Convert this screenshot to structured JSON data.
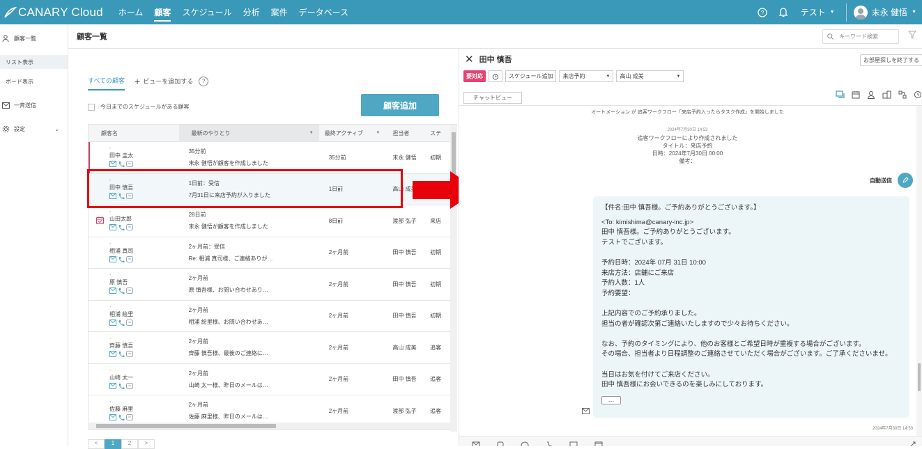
{
  "app": {
    "logo": "CANARY Cloud"
  },
  "nav": [
    {
      "label": "ホーム",
      "active": false
    },
    {
      "label": "顧客",
      "active": true
    },
    {
      "label": "スケジュール",
      "active": false
    },
    {
      "label": "分析",
      "active": false
    },
    {
      "label": "案件",
      "active": false
    },
    {
      "label": "データベース",
      "active": false
    }
  ],
  "topright": {
    "workspace": "テスト",
    "user": "末永 健悟"
  },
  "sidebar": {
    "customer_list": "顧客一覧",
    "list_view": "リスト表示",
    "board_view": "ボード表示",
    "bulk_send": "一斉送信",
    "settings": "設定"
  },
  "page": {
    "title": "顧客一覧",
    "search_placeholder": "キーワード検索"
  },
  "tabs": {
    "all": "すべての顧客",
    "add_view": "ビューを追加する"
  },
  "filter": {
    "today_schedule": "今日までのスケジュールがある顧客"
  },
  "add_button": "顧客追加",
  "table": {
    "headers": [
      "顧客名",
      "最新のやりとり",
      "最終アクティブ",
      "担当者",
      "ステ"
    ],
    "rows": [
      {
        "dash": "-",
        "name": "田中 圭太",
        "latest_time": "35分前",
        "latest_text": "末永 健悟が顧客を作成しました",
        "active": "35分前",
        "owner": "末永 健悟",
        "status": "初期",
        "marker": true,
        "calendar": false,
        "selected": false
      },
      {
        "dash": "-",
        "name": "田中 慎吾",
        "latest_time": "1日前：受信",
        "latest_text": "7月31日に来店予約が入りました",
        "active": "1日前",
        "owner": "高山 成美",
        "status": "",
        "marker": false,
        "calendar": false,
        "selected": true
      },
      {
        "dash": "-",
        "name": "山田太郎",
        "latest_time": "28日前",
        "latest_text": "末永 健悟が顧客を作成しました",
        "active": "8日前",
        "owner": "渡部 弘子",
        "status": "来店",
        "marker": false,
        "calendar": true,
        "selected": false
      },
      {
        "dash": "-",
        "name": "相浦 真司",
        "latest_time": "2ヶ月前：受信",
        "latest_text": "Re: 相浦 真司様、ご連絡ありが…",
        "active": "2ヶ月前",
        "owner": "田中 慎吾",
        "status": "初期",
        "marker": false,
        "calendar": false,
        "selected": false
      },
      {
        "dash": "-",
        "name": "原 慎吾",
        "latest_time": "2ヶ月前",
        "latest_text": "原 慎吾様、お問い合わせあり…",
        "active": "2ヶ月前",
        "owner": "田中 慎吾",
        "status": "初期",
        "marker": false,
        "calendar": false,
        "selected": false
      },
      {
        "dash": "-",
        "name": "相浦 絵里",
        "latest_time": "2ヶ月前",
        "latest_text": "相浦 絵里様、お問い合わせあ…",
        "active": "2ヶ月前",
        "owner": "田中 慎吾",
        "status": "初期",
        "marker": false,
        "calendar": false,
        "selected": false
      },
      {
        "dash": "-",
        "name": "齊藤 慎吾",
        "latest_time": "2ヶ月前",
        "latest_text": "齊藤 慎吾様、最後のご連絡に…",
        "active": "2ヶ月前",
        "owner": "高山 成美",
        "status": "追客",
        "marker": false,
        "calendar": false,
        "selected": false
      },
      {
        "dash": "-",
        "name": "山崎 太一",
        "latest_time": "2ヶ月前",
        "latest_text": "山崎 太一様、昨日のメールは…",
        "active": "2ヶ月前",
        "owner": "田中 慎吾",
        "status": "追客",
        "marker": false,
        "calendar": false,
        "selected": false
      },
      {
        "dash": "-",
        "name": "佐藤 麻里",
        "latest_time": "2ヶ月前",
        "latest_text": "佐藤 麻里様、昨日のメールは…",
        "active": "2ヶ月前",
        "owner": "渡部 弘子",
        "status": "追客",
        "marker": false,
        "calendar": false,
        "selected": false
      }
    ]
  },
  "pager": {
    "prev": "<",
    "current": "1",
    "next_page": "2",
    "next": ">"
  },
  "detail": {
    "name": "田中 慎吾",
    "end_button": "お部屋探しを終了する",
    "urgent": "要対応",
    "schedule_add": "スケジュール追加",
    "select1": "来店予約",
    "select2": "高山 成美",
    "chat_view": "チャットビュー",
    "automation": "オートメーション が 追客ワークフロー「来店予約入ったらタスク作成」を開始しました",
    "sys_time": "2024年7月30日 14:53",
    "sys_lines": [
      "追客ワークフローにより作成されました",
      "タイトル：来店予約",
      "日時：2024年7月30日 00:00",
      "備考："
    ],
    "auto_send": "自動送信",
    "mail_subject": "【件名:田中 慎吾様。ご予約ありがとうございます。】",
    "mail_lines": [
      "<To: kimishima@canary-inc.jp>",
      "田中 慎吾様。ご予約ありがとうございます。",
      "テストでございます。",
      "",
      "予約日時：2024年 07月 31日 10:00",
      "来店方法：店舗にご来店",
      "予約人数：1人",
      "予約要望：",
      "",
      "上記内容でのご予約承りました。",
      "担当の者が確認次第ご連絡いたしますので少々お待ちください。",
      "",
      "なお、予約のタイミングにより、他のお客様とご希望日時が重複する場合がございます。",
      "その場合、担当者より日程調整のご連絡させていただく場合がございます。ご了承くださいませ。",
      "",
      "当日はお気を付けてご来店ください。",
      "田中 慎吾様にお会いできるのを楽しみにしております。"
    ],
    "more": "…",
    "mail_time": "2024年7月30日 14:53"
  },
  "colors": {
    "brand": "#3a98b8",
    "accent_button": "#4ea8c4",
    "urgent": "#e64271",
    "highlight": "#e8000b"
  }
}
